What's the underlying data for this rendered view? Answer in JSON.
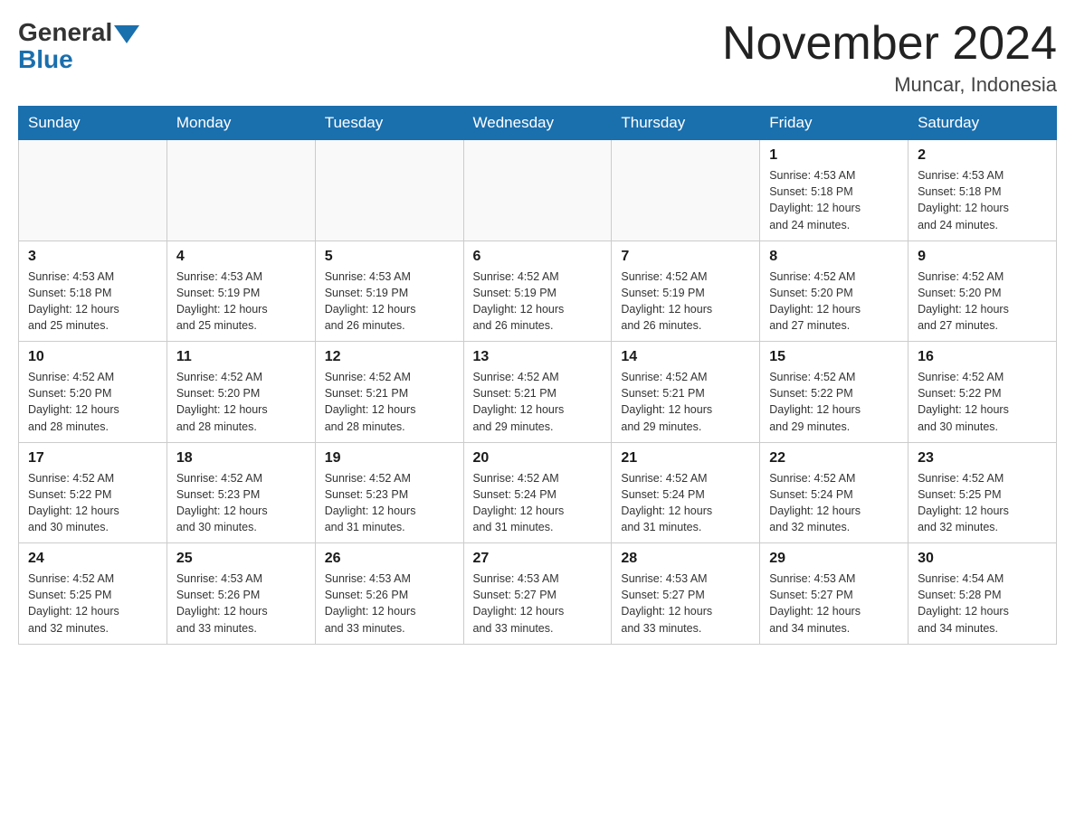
{
  "logo": {
    "general": "General",
    "blue": "Blue"
  },
  "header": {
    "month_year": "November 2024",
    "location": "Muncar, Indonesia"
  },
  "days_of_week": [
    "Sunday",
    "Monday",
    "Tuesday",
    "Wednesday",
    "Thursday",
    "Friday",
    "Saturday"
  ],
  "weeks": [
    {
      "cells": [
        {
          "num": "",
          "info": ""
        },
        {
          "num": "",
          "info": ""
        },
        {
          "num": "",
          "info": ""
        },
        {
          "num": "",
          "info": ""
        },
        {
          "num": "",
          "info": ""
        },
        {
          "num": "1",
          "info": "Sunrise: 4:53 AM\nSunset: 5:18 PM\nDaylight: 12 hours\nand 24 minutes."
        },
        {
          "num": "2",
          "info": "Sunrise: 4:53 AM\nSunset: 5:18 PM\nDaylight: 12 hours\nand 24 minutes."
        }
      ]
    },
    {
      "cells": [
        {
          "num": "3",
          "info": "Sunrise: 4:53 AM\nSunset: 5:18 PM\nDaylight: 12 hours\nand 25 minutes."
        },
        {
          "num": "4",
          "info": "Sunrise: 4:53 AM\nSunset: 5:19 PM\nDaylight: 12 hours\nand 25 minutes."
        },
        {
          "num": "5",
          "info": "Sunrise: 4:53 AM\nSunset: 5:19 PM\nDaylight: 12 hours\nand 26 minutes."
        },
        {
          "num": "6",
          "info": "Sunrise: 4:52 AM\nSunset: 5:19 PM\nDaylight: 12 hours\nand 26 minutes."
        },
        {
          "num": "7",
          "info": "Sunrise: 4:52 AM\nSunset: 5:19 PM\nDaylight: 12 hours\nand 26 minutes."
        },
        {
          "num": "8",
          "info": "Sunrise: 4:52 AM\nSunset: 5:20 PM\nDaylight: 12 hours\nand 27 minutes."
        },
        {
          "num": "9",
          "info": "Sunrise: 4:52 AM\nSunset: 5:20 PM\nDaylight: 12 hours\nand 27 minutes."
        }
      ]
    },
    {
      "cells": [
        {
          "num": "10",
          "info": "Sunrise: 4:52 AM\nSunset: 5:20 PM\nDaylight: 12 hours\nand 28 minutes."
        },
        {
          "num": "11",
          "info": "Sunrise: 4:52 AM\nSunset: 5:20 PM\nDaylight: 12 hours\nand 28 minutes."
        },
        {
          "num": "12",
          "info": "Sunrise: 4:52 AM\nSunset: 5:21 PM\nDaylight: 12 hours\nand 28 minutes."
        },
        {
          "num": "13",
          "info": "Sunrise: 4:52 AM\nSunset: 5:21 PM\nDaylight: 12 hours\nand 29 minutes."
        },
        {
          "num": "14",
          "info": "Sunrise: 4:52 AM\nSunset: 5:21 PM\nDaylight: 12 hours\nand 29 minutes."
        },
        {
          "num": "15",
          "info": "Sunrise: 4:52 AM\nSunset: 5:22 PM\nDaylight: 12 hours\nand 29 minutes."
        },
        {
          "num": "16",
          "info": "Sunrise: 4:52 AM\nSunset: 5:22 PM\nDaylight: 12 hours\nand 30 minutes."
        }
      ]
    },
    {
      "cells": [
        {
          "num": "17",
          "info": "Sunrise: 4:52 AM\nSunset: 5:22 PM\nDaylight: 12 hours\nand 30 minutes."
        },
        {
          "num": "18",
          "info": "Sunrise: 4:52 AM\nSunset: 5:23 PM\nDaylight: 12 hours\nand 30 minutes."
        },
        {
          "num": "19",
          "info": "Sunrise: 4:52 AM\nSunset: 5:23 PM\nDaylight: 12 hours\nand 31 minutes."
        },
        {
          "num": "20",
          "info": "Sunrise: 4:52 AM\nSunset: 5:24 PM\nDaylight: 12 hours\nand 31 minutes."
        },
        {
          "num": "21",
          "info": "Sunrise: 4:52 AM\nSunset: 5:24 PM\nDaylight: 12 hours\nand 31 minutes."
        },
        {
          "num": "22",
          "info": "Sunrise: 4:52 AM\nSunset: 5:24 PM\nDaylight: 12 hours\nand 32 minutes."
        },
        {
          "num": "23",
          "info": "Sunrise: 4:52 AM\nSunset: 5:25 PM\nDaylight: 12 hours\nand 32 minutes."
        }
      ]
    },
    {
      "cells": [
        {
          "num": "24",
          "info": "Sunrise: 4:52 AM\nSunset: 5:25 PM\nDaylight: 12 hours\nand 32 minutes."
        },
        {
          "num": "25",
          "info": "Sunrise: 4:53 AM\nSunset: 5:26 PM\nDaylight: 12 hours\nand 33 minutes."
        },
        {
          "num": "26",
          "info": "Sunrise: 4:53 AM\nSunset: 5:26 PM\nDaylight: 12 hours\nand 33 minutes."
        },
        {
          "num": "27",
          "info": "Sunrise: 4:53 AM\nSunset: 5:27 PM\nDaylight: 12 hours\nand 33 minutes."
        },
        {
          "num": "28",
          "info": "Sunrise: 4:53 AM\nSunset: 5:27 PM\nDaylight: 12 hours\nand 33 minutes."
        },
        {
          "num": "29",
          "info": "Sunrise: 4:53 AM\nSunset: 5:27 PM\nDaylight: 12 hours\nand 34 minutes."
        },
        {
          "num": "30",
          "info": "Sunrise: 4:54 AM\nSunset: 5:28 PM\nDaylight: 12 hours\nand 34 minutes."
        }
      ]
    }
  ]
}
